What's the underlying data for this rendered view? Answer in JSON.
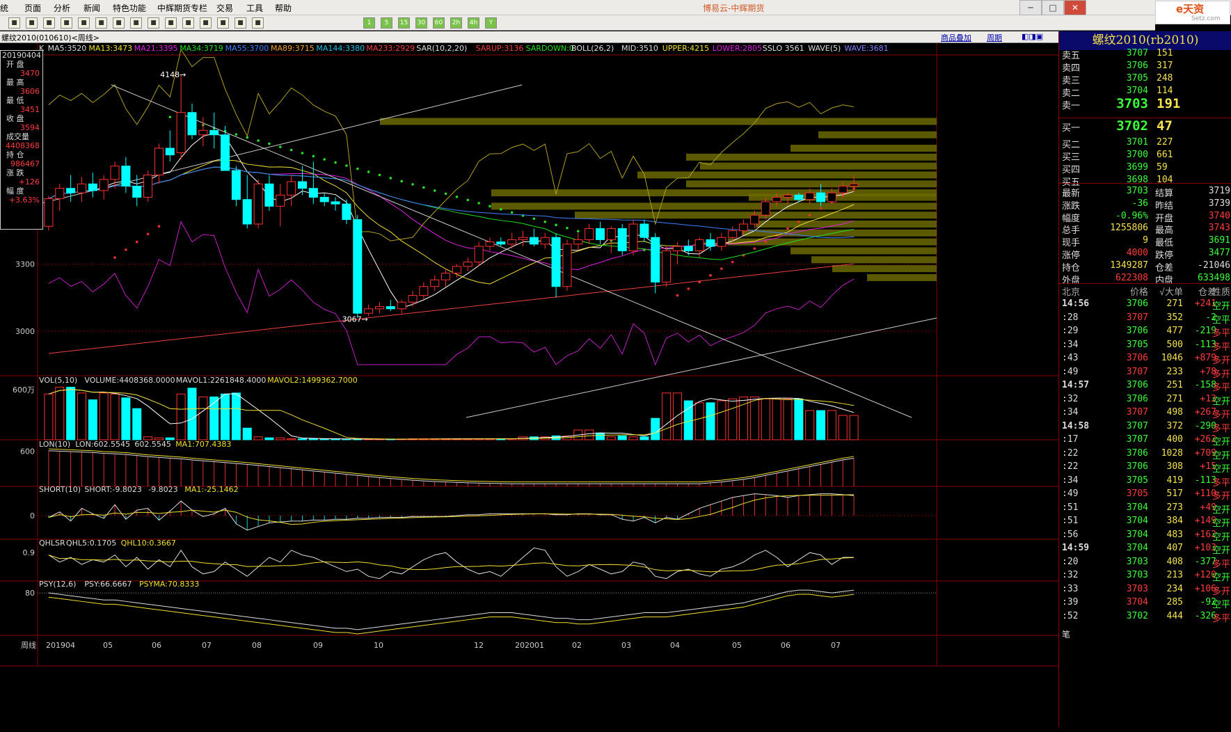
{
  "app_title": "博易云-中辉期货",
  "menu": [
    "统",
    "页面",
    "分析",
    "新闻",
    "特色功能",
    "中辉期货专栏",
    "交易",
    "工具",
    "帮助"
  ],
  "toolbar": {
    "period_buttons": [
      "1",
      "5",
      "15",
      "30",
      "60",
      "2h",
      "4h",
      "Y"
    ]
  },
  "logo": {
    "text": "e天资",
    "sub": "Setz.com"
  },
  "window": {
    "title": "螺纹2010(010610)<周线>",
    "links": [
      "商品叠加",
      "周期"
    ]
  },
  "info_panel": {
    "date": "20190404",
    "labels": [
      "开 盘",
      "最 高",
      "最 低",
      "收 盘",
      "成交量",
      "持 仓",
      "涨 跌",
      "幅 度"
    ],
    "values": [
      "3470",
      "3606",
      "3451",
      "3594",
      "4408368",
      "986467",
      "+126",
      "+3.63%"
    ]
  },
  "indicators": {
    "main": [
      "K",
      "MA5:3520",
      "MA13:3473",
      "MA21:3395",
      "MA34:3719",
      "MA55:3700",
      "MA89:3715",
      "MA144:3380",
      "MA233:2929",
      "SAR(10,2,20)",
      "SARUP:3136",
      "SARDOWN:0",
      "BOLL(26,2)",
      "MID:3510",
      "UPPER:4215",
      "LOWER:2805",
      "SSLO 3561",
      "WAVE(5)",
      "WAVE:3681"
    ],
    "vol": [
      "VOL(5,10)",
      "VOLUME:4408368.0000",
      "MAVOL1:2261848.4000",
      "MAVOL2:1499362.7000"
    ],
    "lon": [
      "LON(10)",
      "LON:602.5545",
      "602.5545",
      "MA1:707.4383"
    ],
    "short": [
      "SHORT(10)",
      "SHORT:-9.8023",
      "-9.8023",
      "MA1:-25.1462"
    ],
    "qhlsr": [
      "QHLSR",
      "QHL5:0.1705",
      "QHL10:0.3667"
    ],
    "psy": [
      "PSY(12,6)",
      "PSY:66.6667",
      "PSYMA:70.8333"
    ]
  },
  "axis": {
    "price_ticks": [
      "3300",
      "3000"
    ],
    "vol_tick": "600万",
    "lon_tick": "600",
    "short_tick": "0",
    "qhlsr_tick": "0.9",
    "psy_tick": "80",
    "x_labels": [
      "周线",
      "201904",
      "05",
      "06",
      "07",
      "08",
      "09",
      "10",
      "12",
      "202001",
      "02",
      "03",
      "04",
      "05",
      "06",
      "07"
    ],
    "high_mark": "4148",
    "low_mark": "3067"
  },
  "chart_data": {
    "type": "candlestick",
    "period": "weekly",
    "instrument": "螺纹2010",
    "high_mark": 4148,
    "low_mark": 3067,
    "ohlc": [
      [
        3470,
        3606,
        3451,
        3594
      ],
      [
        3594,
        3660,
        3540,
        3640
      ],
      [
        3640,
        3700,
        3580,
        3620
      ],
      [
        3620,
        3690,
        3580,
        3660
      ],
      [
        3660,
        3710,
        3600,
        3630
      ],
      [
        3630,
        3700,
        3590,
        3680
      ],
      [
        3680,
        3760,
        3640,
        3740
      ],
      [
        3740,
        3780,
        3620,
        3650
      ],
      [
        3650,
        3700,
        3560,
        3600
      ],
      [
        3600,
        3720,
        3580,
        3700
      ],
      [
        3700,
        3840,
        3660,
        3820
      ],
      [
        3820,
        3900,
        3760,
        3790
      ],
      [
        3800,
        4148,
        3770,
        3980
      ],
      [
        3980,
        4020,
        3860,
        3880
      ],
      [
        3880,
        3960,
        3830,
        3900
      ],
      [
        3900,
        3980,
        3820,
        3880
      ],
      [
        3880,
        3920,
        3720,
        3720
      ],
      [
        3720,
        3740,
        3560,
        3590
      ],
      [
        3590,
        3700,
        3460,
        3480
      ],
      [
        3480,
        3680,
        3460,
        3660
      ],
      [
        3660,
        3700,
        3540,
        3560
      ],
      [
        3560,
        3660,
        3470,
        3610
      ],
      [
        3610,
        3700,
        3560,
        3670
      ],
      [
        3670,
        3740,
        3610,
        3640
      ],
      [
        3640,
        3760,
        3570,
        3600
      ],
      [
        3600,
        3620,
        3560,
        3580
      ],
      [
        3580,
        3600,
        3540,
        3570
      ],
      [
        3570,
        3590,
        3480,
        3500
      ],
      [
        3500,
        3520,
        3060,
        3080
      ],
      [
        3080,
        3120,
        3067,
        3100
      ],
      [
        3100,
        3130,
        3080,
        3110
      ],
      [
        3110,
        3140,
        3090,
        3100
      ],
      [
        3100,
        3140,
        3080,
        3130
      ],
      [
        3130,
        3180,
        3110,
        3160
      ],
      [
        3160,
        3220,
        3140,
        3200
      ],
      [
        3200,
        3250,
        3180,
        3230
      ],
      [
        3230,
        3280,
        3200,
        3260
      ],
      [
        3260,
        3300,
        3240,
        3290
      ],
      [
        3290,
        3330,
        3270,
        3310
      ],
      [
        3310,
        3400,
        3290,
        3380
      ],
      [
        3380,
        3420,
        3360,
        3400
      ],
      [
        3400,
        3420,
        3380,
        3390
      ],
      [
        3390,
        3440,
        3370,
        3410
      ],
      [
        3410,
        3450,
        3380,
        3420
      ],
      [
        3420,
        3460,
        3380,
        3390
      ],
      [
        3390,
        3440,
        3370,
        3420
      ],
      [
        3420,
        3440,
        3150,
        3200
      ],
      [
        3200,
        3410,
        3180,
        3390
      ],
      [
        3390,
        3440,
        3360,
        3410
      ],
      [
        3410,
        3480,
        3390,
        3460
      ],
      [
        3460,
        3490,
        3390,
        3410
      ],
      [
        3410,
        3470,
        3350,
        3460
      ],
      [
        3460,
        3480,
        3340,
        3360
      ],
      [
        3360,
        3500,
        3340,
        3480
      ],
      [
        3480,
        3500,
        3400,
        3420
      ],
      [
        3420,
        3440,
        3170,
        3220
      ],
      [
        3220,
        3380,
        3200,
        3360
      ],
      [
        3360,
        3400,
        3300,
        3380
      ],
      [
        3380,
        3410,
        3340,
        3360
      ],
      [
        3360,
        3420,
        3330,
        3410
      ],
      [
        3410,
        3440,
        3360,
        3380
      ],
      [
        3380,
        3440,
        3360,
        3420
      ],
      [
        3420,
        3470,
        3400,
        3450
      ],
      [
        3450,
        3500,
        3430,
        3480
      ],
      [
        3480,
        3540,
        3460,
        3520
      ],
      [
        3520,
        3600,
        3500,
        3580
      ],
      [
        3580,
        3620,
        3560,
        3600
      ],
      [
        3600,
        3620,
        3570,
        3610
      ],
      [
        3610,
        3620,
        3580,
        3590
      ],
      [
        3590,
        3640,
        3570,
        3620
      ],
      [
        3620,
        3660,
        3560,
        3580
      ],
      [
        3580,
        3640,
        3570,
        3620
      ],
      [
        3620,
        3670,
        3600,
        3650
      ],
      [
        3650,
        3700,
        3620,
        3660
      ]
    ],
    "volume": [
      470,
      540,
      540,
      480,
      410,
      480,
      470,
      430,
      320,
      30,
      20,
      20,
      470,
      530,
      440,
      440,
      470,
      480,
      120,
      30,
      20,
      20,
      10,
      10,
      10,
      10,
      10,
      5,
      5,
      5,
      5,
      5,
      5,
      10,
      10,
      10,
      10,
      10,
      10,
      10,
      10,
      10,
      10,
      30,
      30,
      30,
      40,
      40,
      100,
      100,
      70,
      30,
      40,
      30,
      30,
      220,
      480,
      480,
      400,
      380,
      380,
      400,
      420,
      440,
      440,
      420,
      420,
      420,
      420,
      300,
      300,
      300,
      250,
      250
    ],
    "lon": [
      602,
      600,
      598,
      596,
      594,
      590,
      588,
      585,
      580,
      575,
      572,
      568,
      565,
      560,
      556,
      552,
      548,
      544,
      540,
      535,
      530,
      525,
      520,
      515,
      510,
      505,
      500,
      495,
      490,
      485,
      480,
      476,
      472,
      468,
      465,
      462,
      460,
      458,
      456,
      455,
      454,
      453,
      452,
      452,
      452,
      452,
      452,
      452,
      452,
      452,
      452,
      452,
      452,
      452,
      452,
      452,
      452,
      452,
      452,
      452,
      456,
      460,
      466,
      472,
      480,
      490,
      500,
      510,
      520,
      530,
      540,
      550,
      560,
      568
    ],
    "short": [
      -10,
      20,
      -30,
      40,
      10,
      -15,
      60,
      -20,
      30,
      40,
      -25,
      25,
      80,
      30,
      -5,
      10,
      40,
      -45,
      -80,
      -60,
      -40,
      -35,
      -30,
      -30,
      -25,
      -25,
      -20,
      -20,
      -15,
      -15,
      -10,
      -10,
      -10,
      -5,
      -5,
      -5,
      -5,
      0,
      5,
      5,
      10,
      10,
      10,
      10,
      10,
      10,
      5,
      5,
      10,
      10,
      5,
      5,
      -20,
      -30,
      -10,
      -40,
      -10,
      -20,
      10,
      40,
      60,
      80,
      100,
      110,
      120,
      115,
      110,
      100,
      110,
      115,
      120,
      120,
      115,
      110
    ],
    "qhlsr": [
      0.85,
      0.7,
      0.8,
      0.65,
      0.75,
      0.7,
      0.85,
      0.6,
      0.8,
      0.55,
      0.75,
      0.6,
      0.95,
      0.6,
      0.45,
      0.5,
      0.7,
      0.55,
      0.4,
      0.6,
      0.8,
      0.7,
      0.95,
      0.85,
      0.8,
      0.7,
      0.6,
      0.5,
      0.55,
      0.4,
      0.35,
      0.5,
      0.45,
      0.6,
      0.75,
      0.85,
      0.9,
      0.7,
      0.55,
      0.45,
      0.5,
      0.4,
      0.6,
      0.8,
      1.0,
      0.95,
      0.6,
      0.4,
      0.5,
      0.65,
      0.55,
      0.45,
      0.5,
      0.7,
      0.65,
      0.4,
      0.35,
      0.5,
      0.55,
      0.45,
      0.4,
      0.55,
      0.6,
      0.7,
      0.85,
      0.95,
      0.8,
      0.6,
      0.75,
      0.9,
      0.85,
      0.65,
      0.8,
      0.8
    ],
    "psy": [
      80,
      78,
      76,
      74,
      72,
      70,
      70,
      68,
      66,
      64,
      62,
      60,
      58,
      56,
      54,
      52,
      50,
      48,
      46,
      44,
      42,
      40,
      38,
      36,
      34,
      32,
      30,
      30,
      28,
      30,
      32,
      34,
      36,
      38,
      40,
      42,
      44,
      46,
      48,
      50,
      52,
      52,
      52,
      50,
      48,
      46,
      44,
      44,
      42,
      42,
      44,
      46,
      48,
      50,
      52,
      52,
      52,
      54,
      56,
      58,
      60,
      62,
      64,
      66,
      70,
      74,
      78,
      82,
      84,
      84,
      82,
      80,
      82,
      84
    ],
    "ma_colors": {
      "MA5": "#ffffff",
      "MA13": "#f0e030",
      "MA21": "#e020e0",
      "MA34": "#20e020",
      "MA55": "#4080ff",
      "MA89": "#f0a030",
      "MA144": "#20c0e0",
      "MA233": "#f04040"
    }
  },
  "quote": {
    "title": "螺纹2010(rb2010)",
    "asks": [
      {
        "label": "卖五",
        "price": "3707",
        "vol": "151"
      },
      {
        "label": "卖四",
        "price": "3706",
        "vol": "317"
      },
      {
        "label": "卖三",
        "price": "3705",
        "vol": "248"
      },
      {
        "label": "卖二",
        "price": "3704",
        "vol": "114"
      },
      {
        "label": "卖一",
        "price": "3703",
        "vol": "191"
      }
    ],
    "bids": [
      {
        "label": "买一",
        "price": "3702",
        "vol": "47"
      },
      {
        "label": "买二",
        "price": "3701",
        "vol": "227"
      },
      {
        "label": "买三",
        "price": "3700",
        "vol": "661"
      },
      {
        "label": "买四",
        "price": "3699",
        "vol": "59"
      },
      {
        "label": "买五",
        "price": "3698",
        "vol": "104"
      }
    ],
    "stats": [
      {
        "l1": "最新",
        "v1": "3703",
        "c1": "green",
        "l2": "结算",
        "v2": "3719",
        "c2": "white"
      },
      {
        "l1": "涨跌",
        "v1": "-36",
        "c1": "green",
        "l2": "昨结",
        "v2": "3739",
        "c2": "white"
      },
      {
        "l1": "幅度",
        "v1": "-0.96%",
        "c1": "green",
        "l2": "开盘",
        "v2": "3740",
        "c2": "red"
      },
      {
        "l1": "总手",
        "v1": "1255806",
        "c1": "yellow",
        "l2": "最高",
        "v2": "3743",
        "c2": "red"
      },
      {
        "l1": "现手",
        "v1": "9",
        "c1": "yellow",
        "l2": "最低",
        "v2": "3691",
        "c2": "green"
      },
      {
        "l1": "涨停",
        "v1": "4000",
        "c1": "red",
        "l2": "跌停",
        "v2": "3477",
        "c2": "green"
      },
      {
        "l1": "持仓",
        "v1": "1349287",
        "c1": "yellow",
        "l2": "仓差",
        "v2": "-21046",
        "c2": "white"
      },
      {
        "l1": "外盘",
        "v1": "622308",
        "c1": "red",
        "l2": "内盘",
        "v2": "633498",
        "c2": "green"
      }
    ],
    "tick_header": {
      "time": "北京",
      "price": "价格",
      "vol": "√大单",
      "diff": "仓差",
      "nat": "性质"
    },
    "ticks": [
      {
        "time": "14:56",
        "price": "3706",
        "pc": "green",
        "vol": "271",
        "diff": "+241",
        "dc": "red",
        "nat": "空开"
      },
      {
        "time": ":28",
        "price": "3707",
        "pc": "red",
        "vol": "352",
        "diff": "-2",
        "dc": "green",
        "nat": "空平"
      },
      {
        "time": ":29",
        "price": "3706",
        "pc": "green",
        "vol": "477",
        "diff": "-219",
        "dc": "green",
        "nat": "多平"
      },
      {
        "time": ":34",
        "price": "3705",
        "pc": "green",
        "vol": "500",
        "diff": "-113",
        "dc": "green",
        "nat": "多平"
      },
      {
        "time": ":43",
        "price": "3706",
        "pc": "red",
        "vol": "1046",
        "diff": "+879",
        "dc": "red",
        "nat": "多开"
      },
      {
        "time": ":49",
        "price": "3707",
        "pc": "red",
        "vol": "233",
        "diff": "+78",
        "dc": "red",
        "nat": "多开"
      },
      {
        "time": "14:57",
        "price": "3706",
        "pc": "green",
        "vol": "251",
        "diff": "-158",
        "dc": "green",
        "nat": "多平"
      },
      {
        "time": ":32",
        "price": "3706",
        "pc": "green",
        "vol": "271",
        "diff": "+13",
        "dc": "red",
        "nat": "空开"
      },
      {
        "time": ":34",
        "price": "3707",
        "pc": "red",
        "vol": "498",
        "diff": "+267",
        "dc": "red",
        "nat": "多开"
      },
      {
        "time": "14:58",
        "price": "3707",
        "pc": "green",
        "vol": "372",
        "diff": "-290",
        "dc": "green",
        "nat": "多平"
      },
      {
        "time": ":17",
        "price": "3707",
        "pc": "green",
        "vol": "400",
        "diff": "+262",
        "dc": "red",
        "nat": "空开"
      },
      {
        "time": ":22",
        "price": "3706",
        "pc": "green",
        "vol": "1028",
        "diff": "+709",
        "dc": "red",
        "nat": "空开"
      },
      {
        "time": ":22",
        "price": "3706",
        "pc": "green",
        "vol": "308",
        "diff": "+15",
        "dc": "red",
        "nat": "空开"
      },
      {
        "time": ":34",
        "price": "3705",
        "pc": "green",
        "vol": "419",
        "diff": "-113",
        "dc": "green",
        "nat": "多平"
      },
      {
        "time": ":49",
        "price": "3705",
        "pc": "red",
        "vol": "517",
        "diff": "+110",
        "dc": "red",
        "nat": "多开"
      },
      {
        "time": ":51",
        "price": "3704",
        "pc": "green",
        "vol": "273",
        "diff": "+49",
        "dc": "red",
        "nat": "空开"
      },
      {
        "time": ":51",
        "price": "3704",
        "pc": "green",
        "vol": "384",
        "diff": "+149",
        "dc": "red",
        "nat": "空开"
      },
      {
        "time": ":56",
        "price": "3704",
        "pc": "green",
        "vol": "483",
        "diff": "+162",
        "dc": "red",
        "nat": "空开"
      },
      {
        "time": "14:59",
        "price": "3704",
        "pc": "green",
        "vol": "407",
        "diff": "+103",
        "dc": "red",
        "nat": "空开"
      },
      {
        "time": ":20",
        "price": "3703",
        "pc": "green",
        "vol": "408",
        "diff": "-377",
        "dc": "green",
        "nat": "多平"
      },
      {
        "time": ":32",
        "price": "3703",
        "pc": "green",
        "vol": "213",
        "diff": "+120",
        "dc": "red",
        "nat": "空开"
      },
      {
        "time": ":33",
        "price": "3703",
        "pc": "red",
        "vol": "234",
        "diff": "+106",
        "dc": "red",
        "nat": "多开"
      },
      {
        "time": ":39",
        "price": "3704",
        "pc": "red",
        "vol": "285",
        "diff": "-92",
        "dc": "green",
        "nat": "空平"
      },
      {
        "time": ":52",
        "price": "3702",
        "pc": "green",
        "vol": "444",
        "diff": "-326",
        "dc": "green",
        "nat": "多平"
      }
    ],
    "footer": "笔"
  }
}
